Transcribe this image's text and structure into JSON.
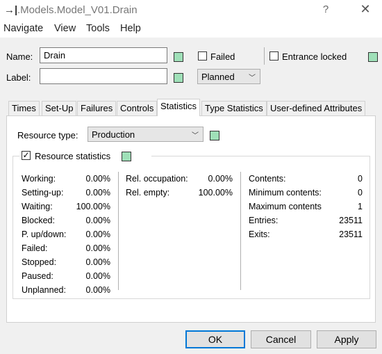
{
  "window": {
    "app_icon": "pin-icon",
    "title": ".Models.Model_V01.Drain",
    "help_glyph": "?",
    "close_glyph": "✕"
  },
  "menu": [
    "Navigate",
    "View",
    "Tools",
    "Help"
  ],
  "header": {
    "name_label": "Name:",
    "name_value": "Drain",
    "label_label": "Label:",
    "label_value": "",
    "failed_label": "Failed",
    "failed_checked": false,
    "entrance_locked_label": "Entrance locked",
    "entrance_locked_checked": false,
    "planned_value": "Planned"
  },
  "tabs": [
    "Times",
    "Set-Up",
    "Failures",
    "Controls",
    "Statistics",
    "Type Statistics",
    "User-defined Attributes"
  ],
  "active_tab": "Statistics",
  "statistics": {
    "resource_type_label": "Resource type:",
    "resource_type_value": "Production",
    "resource_stats_label": "Resource statistics",
    "resource_stats_checked": true,
    "col1": [
      {
        "label": "Working:",
        "value": "0.00%"
      },
      {
        "label": "Setting-up:",
        "value": "0.00%"
      },
      {
        "label": "Waiting:",
        "value": "100.00%"
      },
      {
        "label": "Blocked:",
        "value": "0.00%"
      },
      {
        "label": "P. up/down:",
        "value": "0.00%"
      },
      {
        "label": "Failed:",
        "value": "0.00%"
      },
      {
        "label": "Stopped:",
        "value": "0.00%"
      },
      {
        "label": "Paused:",
        "value": "0.00%"
      },
      {
        "label": "Unplanned:",
        "value": "0.00%"
      }
    ],
    "col2": [
      {
        "label": "Rel. occupation:",
        "value": "0.00%"
      },
      {
        "label": "Rel. empty:",
        "value": "100.00%"
      }
    ],
    "col3": [
      {
        "label": "Contents:",
        "value": "0"
      },
      {
        "label": "Minimum contents:",
        "value": "0"
      },
      {
        "label": "Maximum contents",
        "value": "1"
      },
      {
        "label": "Entries:",
        "value": "23511"
      },
      {
        "label": "Exits:",
        "value": "23511"
      }
    ]
  },
  "buttons": {
    "ok": "OK",
    "cancel": "Cancel",
    "apply": "Apply"
  },
  "colors": {
    "inheritance_box": "#9fe0b8",
    "default_button_border": "#0078d7"
  }
}
